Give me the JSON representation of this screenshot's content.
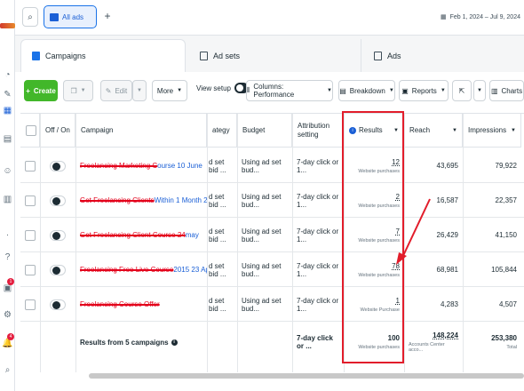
{
  "topbar": {
    "tab_label": "All ads",
    "date_range": "Feb 1, 2024 – Jul 9, 2024"
  },
  "level_tabs": [
    {
      "label": "Campaigns"
    },
    {
      "label": "Ad sets"
    },
    {
      "label": "Ads"
    }
  ],
  "toolbar": {
    "create": "Create",
    "edit": "Edit",
    "more": "More",
    "view_setup": "View setup",
    "columns": "Columns: Performance",
    "breakdown": "Breakdown",
    "reports": "Reports",
    "charts": "Charts"
  },
  "table": {
    "headers": {
      "off_on": "Off / On",
      "campaign": "Campaign",
      "strategy": "ategy",
      "budget": "Budget",
      "attribution": "Attribution setting",
      "results": "Results",
      "reach": "Reach",
      "impressions": "Impressions"
    },
    "rows": [
      {
        "name_struck": "Freelancing Marketing C",
        "name_visible": "ourse 10 June",
        "strategy": "d set bid ...",
        "budget": "Using ad set bud...",
        "attribution": "7-day click or 1...",
        "results": "12",
        "results_sub": "Website purchases",
        "reach": "43,695",
        "impressions": "79,922"
      },
      {
        "name_struck": "Get Freelancing Clients ",
        "name_visible": "Within 1 Month 29 May",
        "strategy": "d set bid ...",
        "budget": "Using ad set bud...",
        "attribution": "7-day click or 1...",
        "results": "2",
        "results_sub": "Website purchases",
        "reach": "16,587",
        "impressions": "22,357"
      },
      {
        "name_struck": "Get Freelancing Client Course 24 ",
        "name_visible": "may",
        "strategy": "d set bid ...",
        "budget": "Using ad set bud...",
        "attribution": "7-day click or 1...",
        "results": "7",
        "results_sub": "Website purchases",
        "reach": "26,429",
        "impressions": "41,150"
      },
      {
        "name_struck": "Freelancing Free Live Course ",
        "name_visible": "2015 23 Apr",
        "strategy": "d set bid ...",
        "budget": "Using ad set bud...",
        "attribution": "7-day click or 1...",
        "results": "78",
        "results_sub": "Website purchases",
        "reach": "68,981",
        "impressions": "105,844"
      },
      {
        "name_struck": "Freelancing Course Offer",
        "name_visible": "",
        "strategy": "d set bid ...",
        "budget": "Using ad set bud...",
        "attribution": "7-day click or 1...",
        "results": "1",
        "results_sub": "Website Purchase",
        "reach": "4,283",
        "impressions": "4,507"
      }
    ],
    "totals": {
      "label": "Results from 5 campaigns",
      "attribution": "7-day click or ...",
      "results": "100",
      "results_sub": "Website purchases",
      "reach": "148,224",
      "reach_sub": "Accounts Center acco...",
      "impressions": "253,380",
      "impressions_sub": "Total"
    }
  },
  "rail_badges": {
    "top": "1",
    "bottom": "4"
  },
  "colors": {
    "accent": "#1a73e8",
    "create_green": "#42b72a",
    "annotation_red": "#e21d2b"
  }
}
